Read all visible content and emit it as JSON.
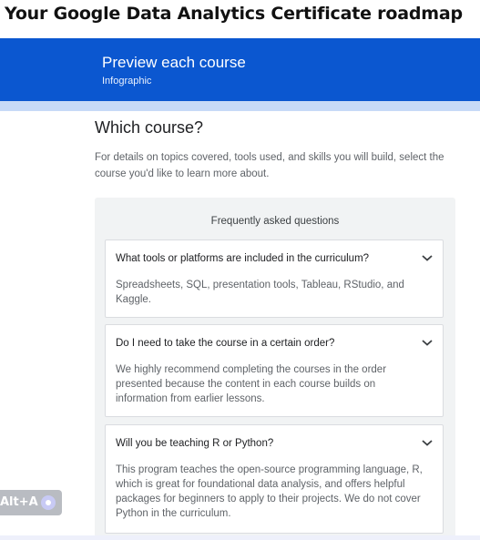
{
  "page": {
    "title": "Your Google Data Analytics Certificate roadmap"
  },
  "banner": {
    "title": "Preview each course",
    "subtitle": "Infographic",
    "color": "#0b57d0"
  },
  "section": {
    "heading": "Which course?",
    "description": "For details on topics covered, tools used, and skills you will build, select the course you'd like to learn more about."
  },
  "faq": {
    "title": "Frequently asked questions",
    "items": [
      {
        "question": "What tools or platforms are included in the curriculum?",
        "answer": "Spreadsheets, SQL, presentation tools, Tableau, RStudio, and Kaggle."
      },
      {
        "question": "Do I need to take the course in a certain order?",
        "answer": "We highly recommend completing the courses in the order presented because the content in each course builds on information from earlier lessons."
      },
      {
        "question": "Will you be teaching R or Python?",
        "answer": "This program teaches the open-source programming language, R, which is great for foundational data analysis, and offers helpful packages for beginners to apply to their projects. We do not cover Python in the curriculum."
      }
    ]
  },
  "overlay": {
    "shortcut_label": "Alt+A"
  },
  "icons": {
    "expand": "chevron-down-icon",
    "assistant": "assistant-dot-icon"
  }
}
